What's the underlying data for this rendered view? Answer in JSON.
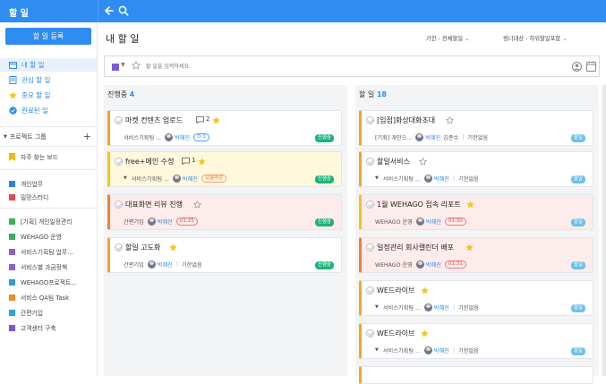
{
  "app": {
    "title": "할 일"
  },
  "sidebar": {
    "add_button": "할 일 등록",
    "nav": [
      {
        "label": "내 할 일",
        "icon": "calendar-icon"
      },
      {
        "label": "관심 할 일",
        "icon": "bookmark-icon"
      },
      {
        "label": "중요 할 일",
        "icon": "star-icon"
      },
      {
        "label": "완료된 일",
        "icon": "check-circle-icon"
      }
    ],
    "project_group": "프로젝트 그룹",
    "frequent_board": "자주 찾는 보드",
    "projects": [
      {
        "label": "개인업무",
        "color": "#2f7fe0"
      },
      {
        "label": "밀망스터디",
        "color": "#e54848"
      },
      {
        "label": "[기획] 개인일정관리",
        "color": "#3aae5a"
      },
      {
        "label": "WEHAGO 운영",
        "color": "#3aae5a"
      },
      {
        "label": "서비스기획팀 업무...",
        "color": "#8e5fd6"
      },
      {
        "label": "서비스별 과금정책",
        "color": "#8e5fd6"
      },
      {
        "label": "WEHAGO프로젝트...",
        "color": "#2f9bd6"
      },
      {
        "label": "서비스 QA팀 Task",
        "color": "#f08a2a"
      },
      {
        "label": "간편기입",
        "color": "#2fa0e6"
      },
      {
        "label": "고객센터 구축",
        "color": "#7a56d9"
      }
    ]
  },
  "main": {
    "title": "내 할 일",
    "filter_period": "기한 - 전체할일",
    "filter_target": "링너대상 - 하위할일포함",
    "input_placeholder": "할 일을 입력하세요."
  },
  "columns": [
    {
      "title": "진행중",
      "count": "4",
      "cards": [
        {
          "title": "마켓 컨텐츠 업로드",
          "comments": "2",
          "starred": true,
          "project": "서비스기획팀 ...",
          "assignee": "박혜진",
          "pill": "D-1",
          "status": "진행중",
          "style": "white"
        },
        {
          "title": "free+메인 수정",
          "comments": "1",
          "starred": true,
          "project": "서비스기획팀 ...",
          "assignee": "박혜진",
          "pill": "오늘마감",
          "status": "진행중",
          "style": "yellow"
        },
        {
          "title": "대표화면 리뷰 진행",
          "starred": false,
          "project": "간편기입",
          "assignee": "박혜진",
          "pill": "01:25",
          "status": "진행중",
          "style": "pink"
        },
        {
          "title": "할일 고도화",
          "starred": true,
          "project": "간편기입",
          "assignee": "박혜진",
          "due": "기한없음",
          "status": "진행중",
          "style": "white"
        }
      ]
    },
    {
      "title": "할 일",
      "count": "18",
      "cards": [
        {
          "title": "[입점]화상대화초대",
          "starred": false,
          "project": "[기획] 개인으...",
          "assignee": "박혜진",
          "extra": "김준수",
          "due": "기한없음",
          "status": "할일",
          "style": "white"
        },
        {
          "title": "할일서비스",
          "starred": false,
          "project": "서비스기획팀 ...",
          "assignee": "박혜진",
          "due": "기한없음",
          "status": "할일",
          "style": "white"
        },
        {
          "title": "1월 WEHAGO 접속 리포트",
          "starred": true,
          "project": "WEHAGO 운영",
          "assignee": "박혜진",
          "pill": "01:30",
          "status": "할일",
          "style": "pink"
        },
        {
          "title": "일정관리 회사캘린더 배포",
          "starred": true,
          "project": "WEHAGO 운영",
          "assignee": "박혜진",
          "pill": "01:31",
          "status": "할일",
          "style": "pink"
        },
        {
          "title": "WE드라이브",
          "starred": true,
          "project": "서비스기획팀 ...",
          "assignee": "박혜진",
          "due": "기한없음",
          "status": "할일",
          "style": "white"
        },
        {
          "title": "WE드라이브",
          "starred": true,
          "project": "서비스기획팀 ...",
          "assignee": "박혜진",
          "due": "기한없음",
          "status": "할일",
          "style": "white"
        }
      ]
    }
  ]
}
